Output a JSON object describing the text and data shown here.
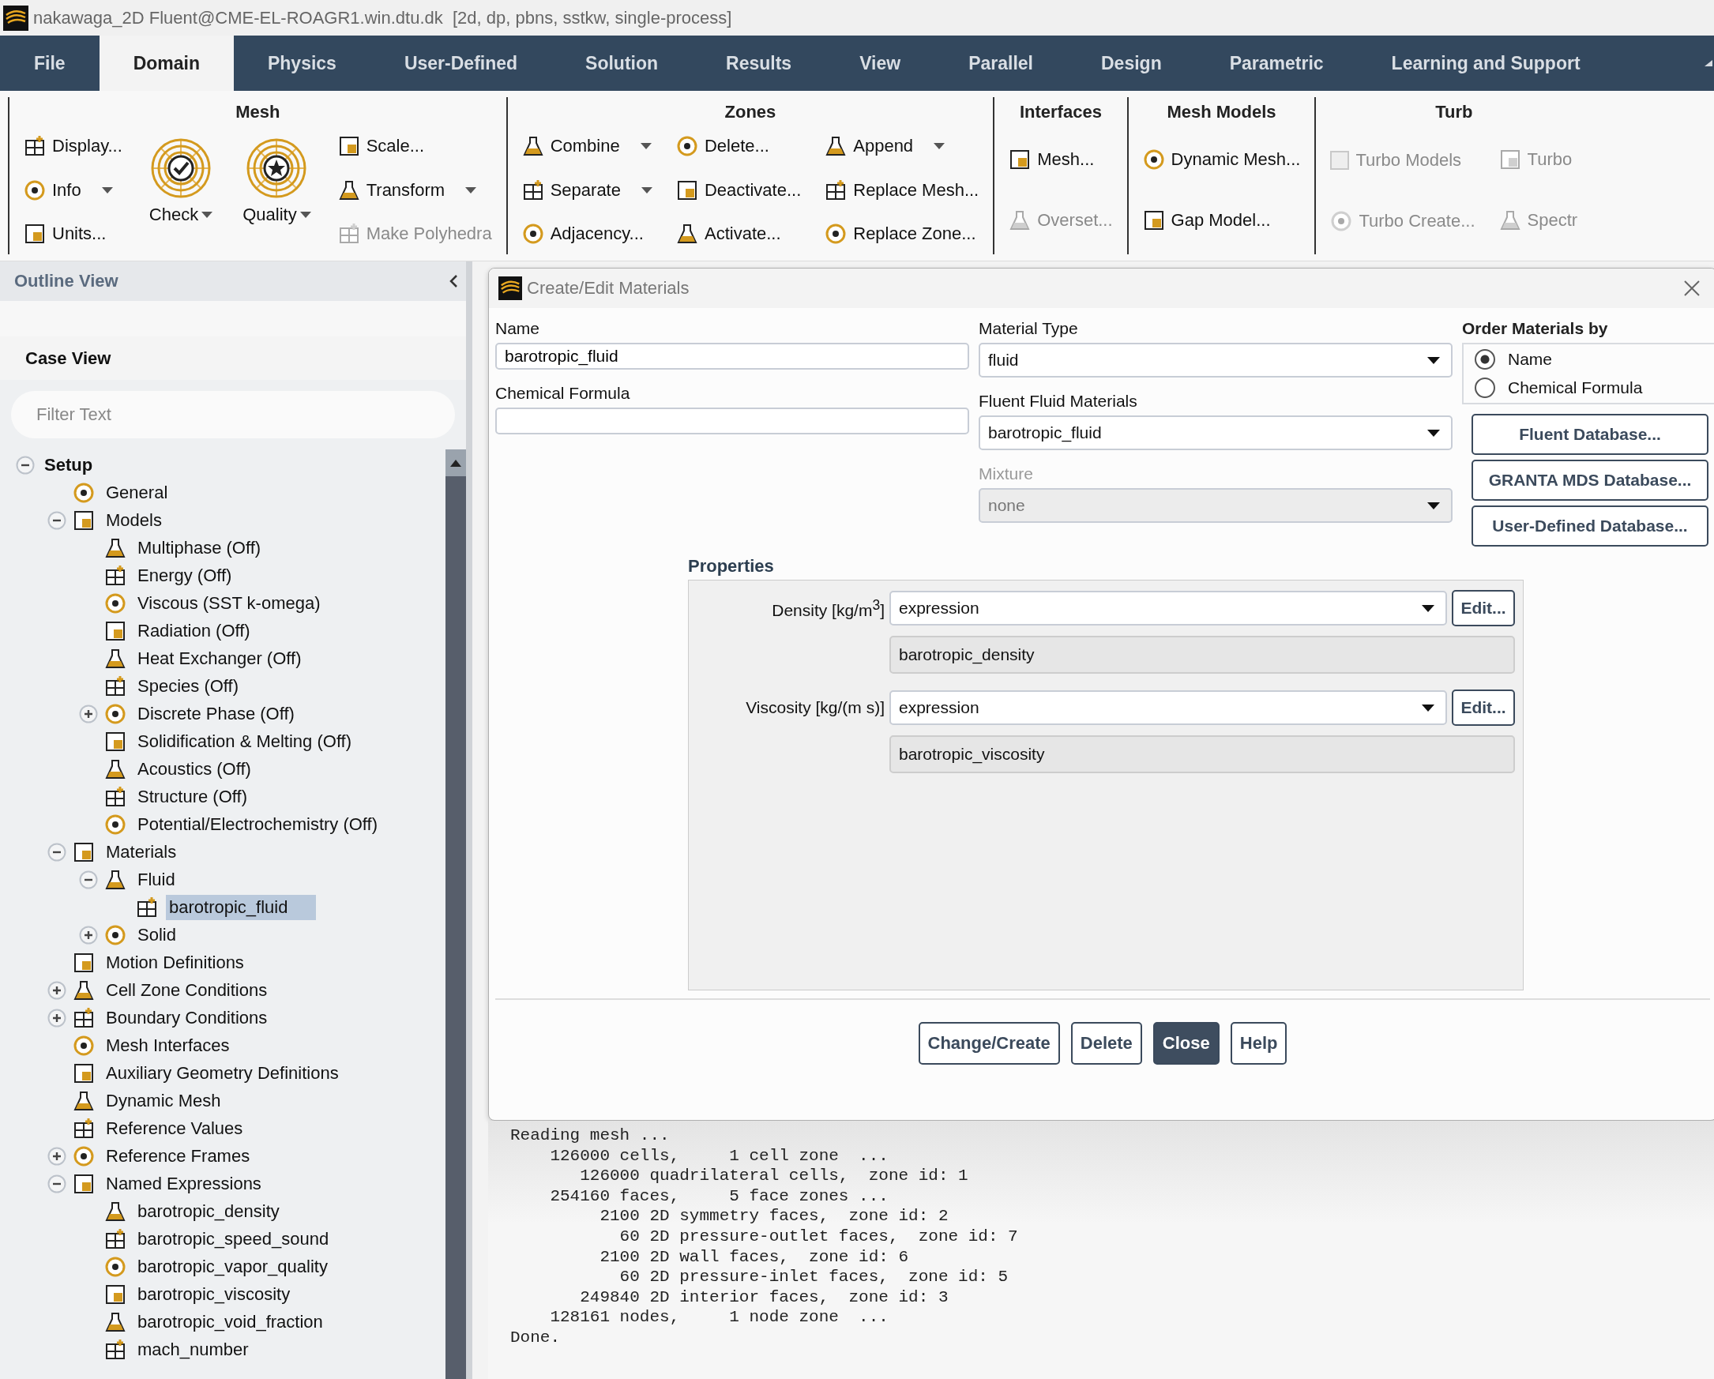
{
  "window": {
    "title": "nakawaga_2D Fluent@CME-EL-ROAGR1.win.dtu.dk  [2d, dp, pbns, sstkw, single-process]"
  },
  "tabs": [
    {
      "label": "File",
      "selected": false
    },
    {
      "label": "Domain",
      "selected": true
    },
    {
      "label": "Physics",
      "selected": false
    },
    {
      "label": "User-Defined",
      "selected": false
    },
    {
      "label": "Solution",
      "selected": false
    },
    {
      "label": "Results",
      "selected": false
    },
    {
      "label": "View",
      "selected": false
    },
    {
      "label": "Parallel",
      "selected": false
    },
    {
      "label": "Design",
      "selected": false
    },
    {
      "label": "Parametric",
      "selected": false
    },
    {
      "label": "Learning and Support",
      "selected": false
    }
  ],
  "ribbon": {
    "groups": [
      {
        "title": "Mesh",
        "columns": [
          [
            {
              "label": "Display...",
              "kind": "button",
              "disabled": false
            },
            {
              "label": "Info",
              "kind": "menubutton",
              "disabled": false
            },
            {
              "label": "Units...",
              "kind": "button",
              "disabled": false
            }
          ],
          [
            {
              "label": "Check",
              "kind": "largemenubutton",
              "disabled": false
            }
          ],
          [
            {
              "label": "Quality",
              "kind": "largemenubutton",
              "disabled": false
            }
          ],
          [
            {
              "label": "Scale...",
              "kind": "button",
              "disabled": false
            },
            {
              "label": "Transform",
              "kind": "menubutton",
              "disabled": false
            },
            {
              "label": "Make Polyhedra",
              "kind": "button",
              "disabled": true
            }
          ]
        ]
      },
      {
        "title": "Zones",
        "columns": [
          [
            {
              "label": "Combine",
              "kind": "menubutton",
              "disabled": false
            },
            {
              "label": "Separate",
              "kind": "menubutton",
              "disabled": false
            },
            {
              "label": "Adjacency...",
              "kind": "button",
              "disabled": false
            }
          ],
          [
            {
              "label": "Delete...",
              "kind": "button",
              "disabled": false
            },
            {
              "label": "Deactivate...",
              "kind": "button",
              "disabled": false
            },
            {
              "label": "Activate...",
              "kind": "button",
              "disabled": false
            }
          ],
          [
            {
              "label": "Append",
              "kind": "menubutton",
              "disabled": false
            },
            {
              "label": "Replace Mesh...",
              "kind": "button",
              "disabled": false
            },
            {
              "label": "Replace Zone...",
              "kind": "button",
              "disabled": false
            }
          ]
        ]
      },
      {
        "title": "Interfaces",
        "columns": [
          [
            {
              "label": "Mesh...",
              "kind": "button",
              "disabled": false
            },
            {
              "label": "Overset...",
              "kind": "button",
              "disabled": true
            }
          ]
        ]
      },
      {
        "title": "Mesh Models",
        "columns": [
          [
            {
              "label": "Dynamic Mesh...",
              "kind": "button",
              "disabled": false
            },
            {
              "label": "Gap Model...",
              "kind": "button",
              "disabled": false
            }
          ]
        ]
      },
      {
        "title": "Turb",
        "columns": [
          [
            {
              "label": "Turbo Models",
              "kind": "checkbox",
              "checked": false,
              "disabled": true
            },
            {
              "label": "Turbo Create...",
              "kind": "button",
              "disabled": true
            }
          ],
          [
            {
              "label": "Turbo",
              "kind": "button",
              "disabled": true
            },
            {
              "label": "Spectr",
              "kind": "button",
              "disabled": true
            }
          ]
        ]
      }
    ]
  },
  "outline": {
    "title": "Outline View",
    "case_view": "Case View",
    "filter": {
      "placeholder": "Filter Text"
    },
    "tree": [
      {
        "label": "Setup",
        "selected": false,
        "expanded": true,
        "children": [
          {
            "label": "General",
            "selected": false
          },
          {
            "label": "Models",
            "selected": false,
            "expanded": true,
            "children": [
              {
                "label": "Multiphase (Off)",
                "selected": false
              },
              {
                "label": "Energy (Off)",
                "selected": false
              },
              {
                "label": "Viscous (SST k-omega)",
                "selected": false
              },
              {
                "label": "Radiation (Off)",
                "selected": false
              },
              {
                "label": "Heat Exchanger (Off)",
                "selected": false
              },
              {
                "label": "Species (Off)",
                "selected": false
              },
              {
                "label": "Discrete Phase (Off)",
                "selected": false,
                "expanded": false
              },
              {
                "label": "Solidification & Melting (Off)",
                "selected": false
              },
              {
                "label": "Acoustics (Off)",
                "selected": false
              },
              {
                "label": "Structure (Off)",
                "selected": false
              },
              {
                "label": "Potential/Electrochemistry (Off)",
                "selected": false
              }
            ]
          },
          {
            "label": "Materials",
            "selected": false,
            "expanded": true,
            "children": [
              {
                "label": "Fluid",
                "selected": false,
                "expanded": true,
                "children": [
                  {
                    "label": "barotropic_fluid",
                    "selected": true
                  }
                ]
              },
              {
                "label": "Solid",
                "selected": false,
                "expanded": false
              }
            ]
          },
          {
            "label": "Motion Definitions",
            "selected": false
          },
          {
            "label": "Cell Zone Conditions",
            "selected": false,
            "expanded": false
          },
          {
            "label": "Boundary Conditions",
            "selected": false,
            "expanded": false
          },
          {
            "label": "Mesh Interfaces",
            "selected": false
          },
          {
            "label": "Auxiliary Geometry Definitions",
            "selected": false
          },
          {
            "label": "Dynamic Mesh",
            "selected": false
          },
          {
            "label": "Reference Values",
            "selected": false
          },
          {
            "label": "Reference Frames",
            "selected": false,
            "expanded": false
          },
          {
            "label": "Named Expressions",
            "selected": false,
            "expanded": true,
            "children": [
              {
                "label": "barotropic_density",
                "selected": false
              },
              {
                "label": "barotropic_speed_sound",
                "selected": false
              },
              {
                "label": "barotropic_vapor_quality",
                "selected": false
              },
              {
                "label": "barotropic_viscosity",
                "selected": false
              },
              {
                "label": "barotropic_void_fraction",
                "selected": false
              },
              {
                "label": "mach_number",
                "selected": false
              }
            ]
          }
        ]
      }
    ]
  },
  "dialog": {
    "title": "Create/Edit Materials",
    "name": {
      "label": "Name",
      "value": "barotropic_fluid"
    },
    "chemical_formula": {
      "label": "Chemical Formula"
    },
    "material_type": {
      "label": "Material Type",
      "value": "fluid"
    },
    "fluent_materials": {
      "label": "Fluent Fluid Materials",
      "value": "barotropic_fluid"
    },
    "mixture": {
      "label": "Mixture",
      "value": "none",
      "disabled": true
    },
    "order_by": {
      "label": "Order Materials by",
      "options": [
        {
          "label": "Name",
          "selected": true
        },
        {
          "label": "Chemical Formula",
          "selected": false
        }
      ]
    },
    "database_buttons": [
      "Fluent Database...",
      "GRANTA MDS Database...",
      "User-Defined Database..."
    ],
    "properties": {
      "title": "Properties",
      "rows": [
        {
          "label": "Density [kg/m$^{3}$]",
          "method": "expression",
          "button": "Edit...",
          "value": "barotropic_density"
        },
        {
          "label": "Viscosity [kg/(m s)]",
          "method": "expression",
          "button": "Edit...",
          "value": "barotropic_viscosity"
        }
      ]
    },
    "buttons": [
      {
        "label": "Change/Create",
        "default": false
      },
      {
        "label": "Delete",
        "default": false
      },
      {
        "label": "Close",
        "default": true
      },
      {
        "label": "Help",
        "default": false
      }
    ]
  },
  "console": {
    "lines": [
      "Reading mesh ...",
      "    126000 cells,     1 cell zone  ...",
      "       126000 quadrilateral cells,  zone id: 1",
      "    254160 faces,     5 face zones ...",
      "         2100 2D symmetry faces,  zone id: 2",
      "           60 2D pressure-outlet faces,  zone id: 7",
      "         2100 2D wall faces,  zone id: 6",
      "           60 2D pressure-inlet faces,  zone id: 5",
      "       249840 2D interior faces,  zone id: 3",
      "    128161 nodes,     1 node zone  ...",
      "Done."
    ]
  }
}
